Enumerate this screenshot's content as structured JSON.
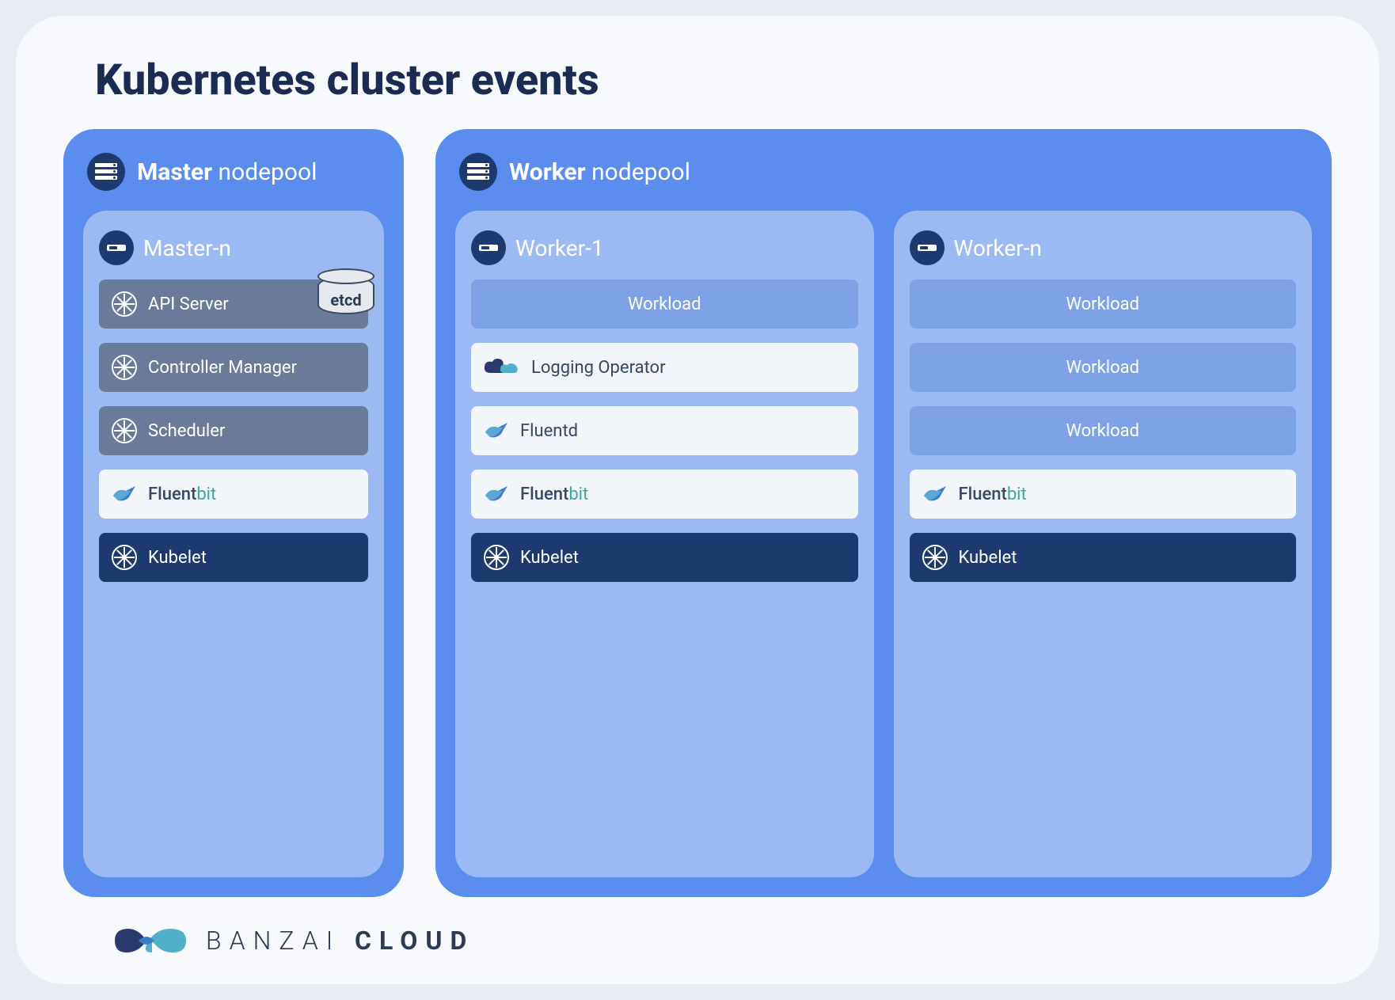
{
  "title": "Kubernetes cluster events",
  "master_pool": {
    "label_bold": "Master",
    "label_rest": "nodepool",
    "node": {
      "name": "Master-n",
      "api_server": "API Server",
      "etcd": "etcd",
      "controller_manager": "Controller Manager",
      "scheduler": "Scheduler",
      "fluentbit": "Fluent",
      "fluentbit_suffix": "bit",
      "kubelet": "Kubelet"
    }
  },
  "worker_pool": {
    "label_bold": "Worker",
    "label_rest": "nodepool",
    "worker1": {
      "name": "Worker-1",
      "workload": "Workload",
      "logging_operator": "Logging Operator",
      "fluentd": "Fluentd",
      "fluentbit": "Fluent",
      "fluentbit_suffix": "bit",
      "kubelet": "Kubelet"
    },
    "workern": {
      "name": "Worker-n",
      "workload1": "Workload",
      "workload2": "Workload",
      "workload3": "Workload",
      "fluentbit": "Fluent",
      "fluentbit_suffix": "bit",
      "kubelet": "Kubelet"
    }
  },
  "footer": {
    "brand_part1": "BANZAI",
    "brand_part2": "CLOUD"
  }
}
